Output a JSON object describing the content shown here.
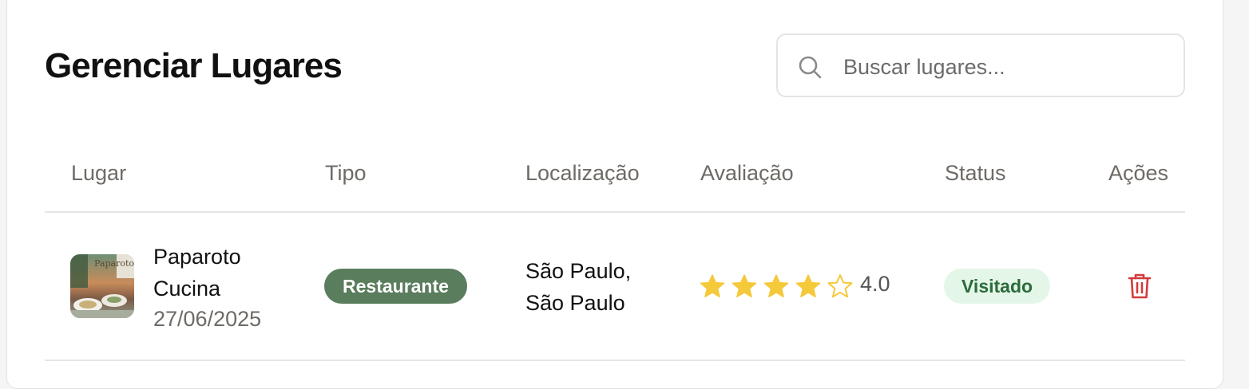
{
  "page": {
    "title": "Gerenciar Lugares"
  },
  "search": {
    "placeholder": "Buscar lugares...",
    "value": ""
  },
  "table": {
    "headers": [
      "Lugar",
      "Tipo",
      "Localização",
      "Avaliação",
      "Status",
      "Ações"
    ],
    "rows": [
      {
        "name": "Paparoto Cucina",
        "date": "27/06/2025",
        "type": "Restaurante",
        "location": "São Paulo, São Paulo",
        "rating": 4,
        "rating_text": "4.0",
        "status": "Visitado",
        "thumbnail_logo_text": "Paparoto"
      }
    ]
  },
  "colors": {
    "type_badge": "#5a7d5d",
    "status_badge_bg": "#e4f6e8",
    "status_badge_text": "#2b6b3c",
    "star_filled": "#f4c93a",
    "delete_icon": "#d23b3b"
  },
  "icons": {
    "search": "search-icon",
    "star": "star-icon",
    "delete": "trash-icon"
  }
}
